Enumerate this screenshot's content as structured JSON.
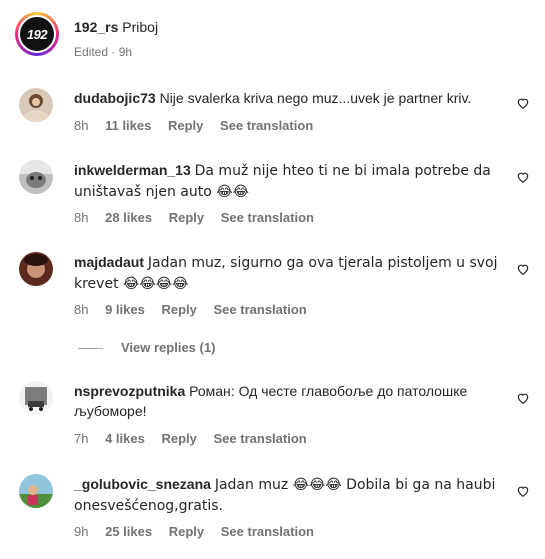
{
  "post": {
    "avatar_text": "192",
    "owner": "192_rs",
    "location": "Priboj",
    "meta": "Edited · 9h"
  },
  "comments": [
    {
      "username": "dudabojic73",
      "text": "Nije svalerka kriva nego muz...uvek je partner kriv.",
      "time": "8h",
      "likes": "11 likes",
      "reply": "Reply",
      "translate": "See translation"
    },
    {
      "username": "inkwelderman_13",
      "text": "Da muž nije hteo ti ne bi imala potrebe da uništavaš njen auto 😂😂",
      "time": "8h",
      "likes": "28 likes",
      "reply": "Reply",
      "translate": "See translation"
    },
    {
      "username": "majdadaut",
      "text": "Jadan muz, sigurno ga ova tjerala pistoljem u svoj krevet 😂😂😂😂",
      "time": "8h",
      "likes": "9 likes",
      "reply": "Reply",
      "translate": "See translation",
      "view_replies": "View replies (1)"
    },
    {
      "username": "nsprevozputnika",
      "text": "Роман: Од честе главобоље до патолошке љубоморе!",
      "time": "7h",
      "likes": "4 likes",
      "reply": "Reply",
      "translate": "See translation"
    },
    {
      "username": "_golubovic_snezana",
      "text": "Jadan muz 😂😂😂 Dobila bi ga na haubi onesvešćenog,gratis.",
      "time": "9h",
      "likes": "25 likes",
      "reply": "Reply",
      "translate": "See translation"
    }
  ],
  "icons": {
    "like": "heart-outline-icon"
  },
  "colors": {
    "text": "#262626",
    "secondary": "#737373"
  }
}
